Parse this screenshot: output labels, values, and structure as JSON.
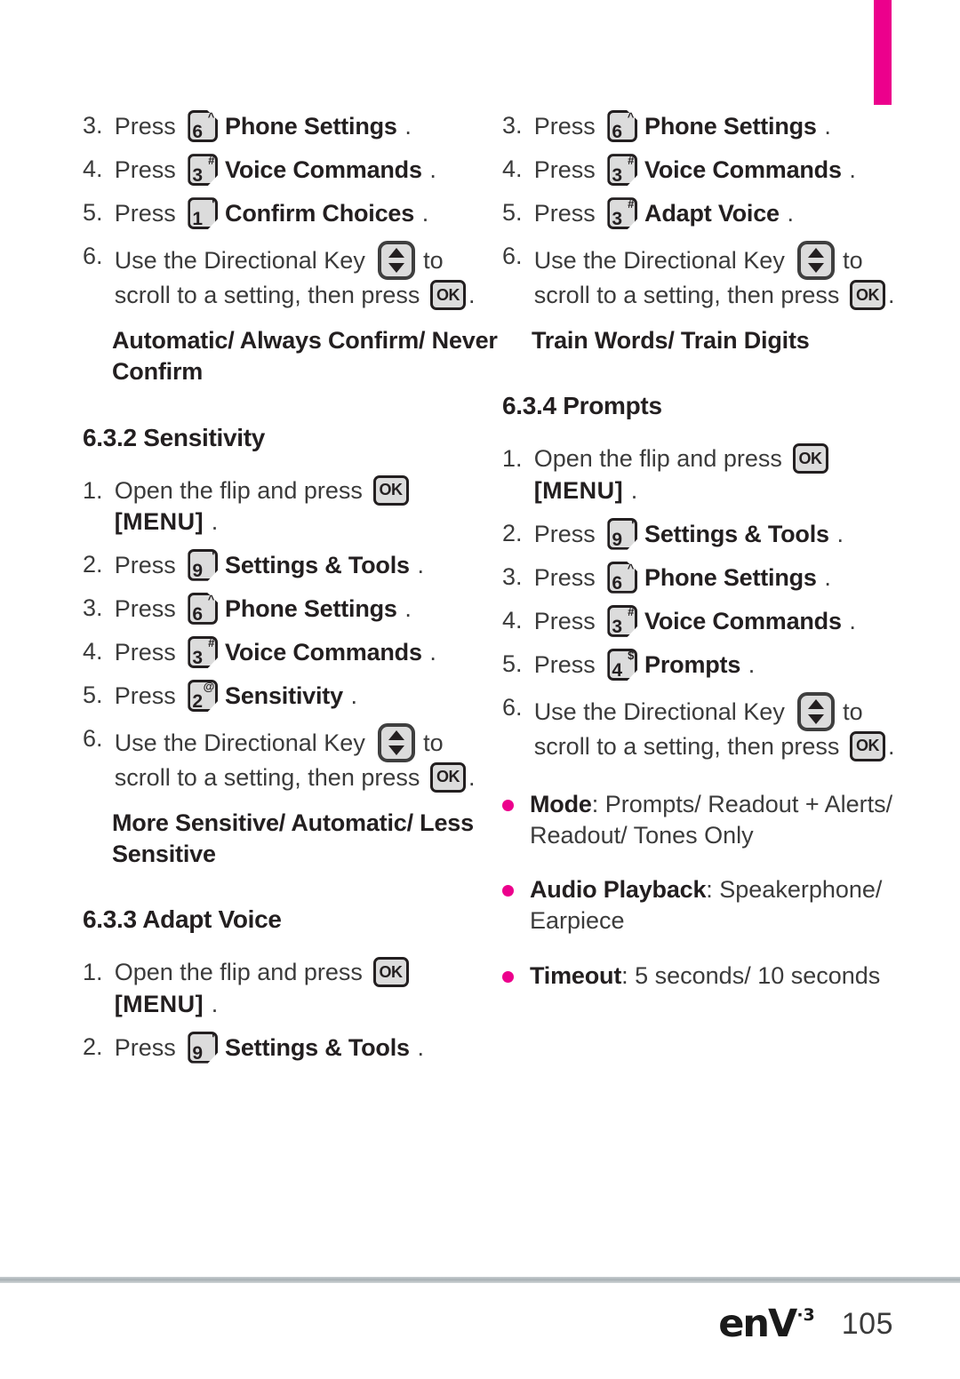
{
  "page": {
    "number": "105",
    "brand": "enV",
    "brand_superscript": "·3"
  },
  "accent_colors": {
    "tab_magenta": "#EC008C",
    "bullet_magenta": "#EC008C",
    "rule_grey": "#a8b1b5"
  },
  "icons": {
    "ok_label": "OK",
    "directional_key": "directional-key-icon"
  },
  "left_column": {
    "steps_confirm_choices": [
      {
        "num": "3.",
        "verb": "Press",
        "key": {
          "digit": "6",
          "sup": "^",
          "cut": "tr"
        },
        "dest": "Phone Settings",
        "period": "."
      },
      {
        "num": "4.",
        "verb": "Press",
        "key": {
          "digit": "3",
          "sup": "#",
          "cut": "br"
        },
        "dest": "Voice Commands",
        "period": "."
      },
      {
        "num": "5.",
        "verb": "Press",
        "key": {
          "digit": "1",
          "sup": "'",
          "cut": "br"
        },
        "dest": "Confirm Choices",
        "period": "."
      }
    ],
    "scroll_step": {
      "num": "6.",
      "text_before": "Use the Directional Key",
      "text_mid": "to",
      "text_after": "scroll to a setting, then press",
      "period": "."
    },
    "options_confirm": "Automatic/ Always Confirm/ Never Confirm",
    "heading_sensitivity": "6.3.2 Sensitivity",
    "open_flip_step": {
      "num": "1.",
      "text": "Open the flip and press",
      "menu": "[MENU]",
      "period": "."
    },
    "steps_sensitivity": [
      {
        "num": "2.",
        "verb": "Press",
        "key": {
          "digit": "9",
          "sup": "'",
          "cut": "br"
        },
        "dest": "Settings & Tools",
        "period": "."
      },
      {
        "num": "3.",
        "verb": "Press",
        "key": {
          "digit": "6",
          "sup": "^",
          "cut": "tr"
        },
        "dest": "Phone Settings",
        "period": "."
      },
      {
        "num": "4.",
        "verb": "Press",
        "key": {
          "digit": "3",
          "sup": "#",
          "cut": "br"
        },
        "dest": "Voice Commands",
        "period": "."
      },
      {
        "num": "5.",
        "verb": "Press",
        "key": {
          "digit": "2",
          "sup": "@",
          "cut": "br"
        },
        "dest": "Sensitivity",
        "period": "."
      }
    ],
    "options_sensitivity": "More Sensitive/ Automatic/ Less Sensitive",
    "heading_adapt_voice": "6.3.3 Adapt Voice",
    "open_flip_step2": {
      "num": "1.",
      "text": "Open the flip and press",
      "menu": "[MENU]",
      "period": "."
    },
    "step_settings_tools": {
      "num": "2.",
      "verb": "Press",
      "key": {
        "digit": "9",
        "sup": "'",
        "cut": "br"
      },
      "dest": "Settings & Tools",
      "period": "."
    }
  },
  "right_column": {
    "steps_adapt_voice": [
      {
        "num": "3.",
        "verb": "Press",
        "key": {
          "digit": "6",
          "sup": "^",
          "cut": "tr"
        },
        "dest": "Phone Settings",
        "period": "."
      },
      {
        "num": "4.",
        "verb": "Press",
        "key": {
          "digit": "3",
          "sup": "#",
          "cut": "br"
        },
        "dest": "Voice Commands",
        "period": "."
      },
      {
        "num": "5.",
        "verb": "Press",
        "key": {
          "digit": "3",
          "sup": "#",
          "cut": "br"
        },
        "dest": "Adapt Voice",
        "period": "."
      }
    ],
    "scroll_step": {
      "num": "6.",
      "text_before": "Use the Directional Key",
      "text_mid": "to",
      "text_after": "scroll to a setting, then press",
      "period": "."
    },
    "options_train": "Train Words/ Train Digits",
    "heading_prompts": "6.3.4 Prompts",
    "open_flip_step": {
      "num": "1.",
      "text": "Open the flip and press",
      "menu": "[MENU]",
      "period": "."
    },
    "steps_prompts": [
      {
        "num": "2.",
        "verb": "Press",
        "key": {
          "digit": "9",
          "sup": "'",
          "cut": "br"
        },
        "dest": "Settings & Tools",
        "period": "."
      },
      {
        "num": "3.",
        "verb": "Press",
        "key": {
          "digit": "6",
          "sup": "^",
          "cut": "tr"
        },
        "dest": "Phone Settings",
        "period": "."
      },
      {
        "num": "4.",
        "verb": "Press",
        "key": {
          "digit": "3",
          "sup": "#",
          "cut": "br"
        },
        "dest": "Voice Commands",
        "period": "."
      },
      {
        "num": "5.",
        "verb": "Press",
        "key": {
          "digit": "4",
          "sup": "$",
          "cut": "br"
        },
        "dest": "Prompts",
        "period": "."
      }
    ],
    "scroll_step2": {
      "num": "6.",
      "text_before": "Use the Directional Key",
      "text_mid": "to",
      "text_after": "scroll to a setting, then press",
      "period": "."
    },
    "bullets": [
      {
        "label": "Mode",
        "value": ": Prompts/ Readout + Alerts/ Readout/ Tones Only"
      },
      {
        "label": "Audio Playback",
        "value": ": Speakerphone/ Earpiece"
      },
      {
        "label": "Timeout",
        "value": ": 5 seconds/ 10 seconds"
      }
    ]
  }
}
